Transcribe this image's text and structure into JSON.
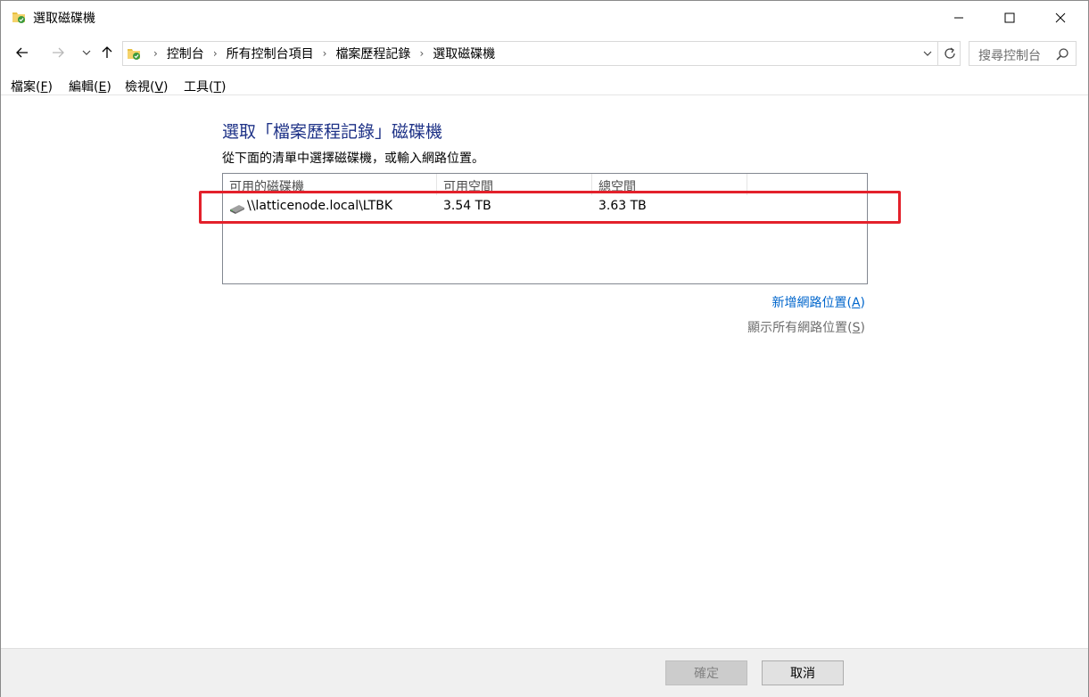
{
  "window": {
    "title": "選取磁碟機",
    "controls": {
      "minimize": "minimize",
      "maximize": "maximize",
      "close": "close"
    }
  },
  "navigation": {
    "breadcrumbs": [
      "控制台",
      "所有控制台項目",
      "檔案歷程記錄",
      "選取磁碟機"
    ],
    "search_placeholder": "搜尋控制台"
  },
  "menu": {
    "file": "檔案(",
    "file_key": "F",
    "edit": "編輯(",
    "edit_key": "E",
    "view": "檢視(",
    "view_key": "V",
    "tools": "工具(",
    "tools_key": "T"
  },
  "content": {
    "heading": "選取「檔案歷程記錄」磁碟機",
    "instruction": "從下面的清單中選擇磁碟機，或輸入網路位置。",
    "table": {
      "columns": [
        "可用的磁碟機",
        "可用空間",
        "總空間"
      ],
      "rows": [
        {
          "name": "\\\\latticenode.local\\LTBK",
          "free": "3.54 TB",
          "total": "3.63 TB",
          "icon": "network-drive-icon"
        }
      ]
    },
    "links": {
      "add_network": "新增網路位置(",
      "add_network_key": "A",
      "show_all": "顯示所有網路位置(",
      "show_all_key": "S"
    }
  },
  "buttons": {
    "ok": "確定",
    "cancel": "取消"
  },
  "colors": {
    "heading": "#1e3287",
    "link": "#0066cc",
    "highlight": "#e3212b"
  }
}
